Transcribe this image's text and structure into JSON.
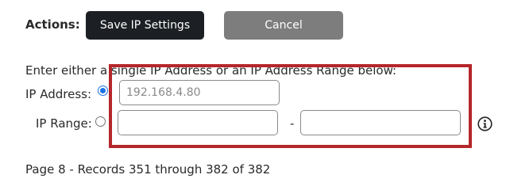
{
  "actions": {
    "label": "Actions:",
    "save_label": "Save IP Settings",
    "cancel_label": "Cancel"
  },
  "form": {
    "instruction": "Enter either a single IP Address or an IP Address Range below:",
    "ip_address": {
      "label": "IP Address:",
      "selected": true,
      "placeholder": "192.168.4.80",
      "value": ""
    },
    "ip_range": {
      "label": "IP Range:",
      "selected": false,
      "start_value": "",
      "end_value": "",
      "separator": "-"
    },
    "info_icon": "info-icon",
    "highlight_color": "#b5262a",
    "radio_selected_color": "#1a73e8"
  },
  "paging": {
    "text": "Page 8 - Records 351 through 382 of 382"
  }
}
